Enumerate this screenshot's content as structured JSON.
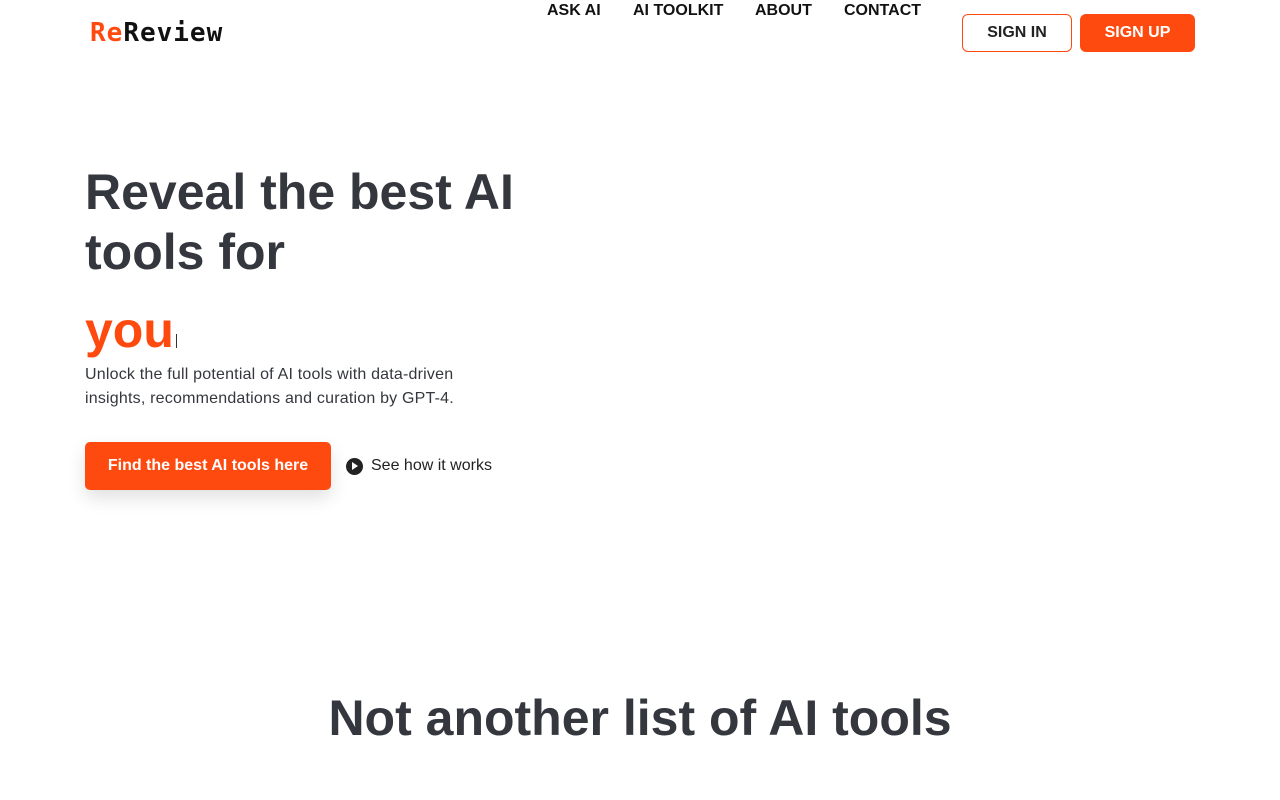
{
  "header": {
    "logo": {
      "prefix": "Re",
      "rest": "Review"
    },
    "nav": [
      {
        "label": "ASK AI"
      },
      {
        "label": "AI TOOLKIT"
      },
      {
        "label": "ABOUT"
      },
      {
        "label": "CONTACT"
      }
    ],
    "sign_in_label": "SIGN IN",
    "sign_up_label": "SIGN UP"
  },
  "hero": {
    "title": "Reveal the best AI tools for",
    "typed_word": "you",
    "subtitle": "Unlock the full potential of AI tools with data-driven insights, recommendations and curation by GPT-4.",
    "cta_label": "Find the best AI tools here",
    "secondary_label": "See how it works"
  },
  "section": {
    "title": "Not another list of AI tools"
  },
  "colors": {
    "accent": "#ff4a0f",
    "text": "#34373d"
  },
  "icons": {
    "secondary_cta": "play-circle-icon"
  }
}
